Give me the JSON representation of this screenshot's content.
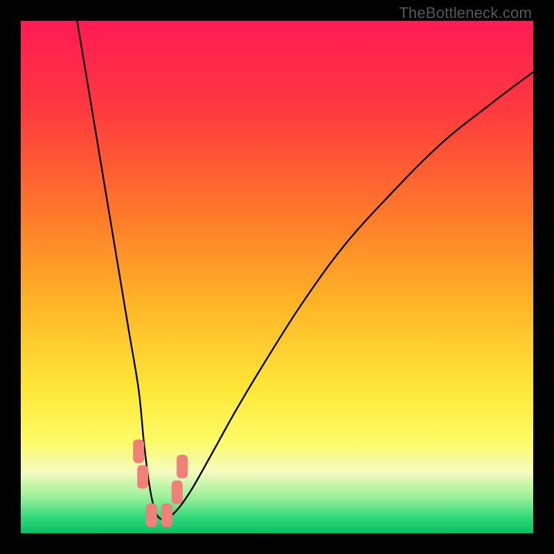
{
  "watermark": "TheBottleneck.com",
  "chart_data": {
    "type": "line",
    "title": "",
    "xlabel": "",
    "ylabel": "",
    "xlim": [
      0,
      100
    ],
    "ylim": [
      0,
      100
    ],
    "series": [
      {
        "name": "bottleneck-curve",
        "x": [
          11,
          13,
          15,
          17,
          19,
          21,
          23,
          24,
          25,
          26,
          27,
          28,
          30,
          33,
          37,
          42,
          48,
          55,
          63,
          72,
          82,
          92,
          100
        ],
        "values": [
          100,
          88,
          76,
          64,
          52,
          40,
          28,
          18,
          10,
          5,
          3,
          3,
          4,
          8,
          15,
          24,
          34,
          45,
          56,
          66,
          76,
          84,
          90
        ]
      }
    ],
    "markers": [
      {
        "name": "marker-1",
        "x": 23.0,
        "y": 16.0
      },
      {
        "name": "marker-2",
        "x": 23.8,
        "y": 11.0
      },
      {
        "name": "marker-3",
        "x": 25.5,
        "y": 3.5
      },
      {
        "name": "marker-4",
        "x": 28.5,
        "y": 3.5
      },
      {
        "name": "marker-5",
        "x": 30.5,
        "y": 8.0
      },
      {
        "name": "marker-6",
        "x": 31.5,
        "y": 13.0
      }
    ],
    "gradient_stops": [
      {
        "offset": 0.0,
        "color": "#ff1a55"
      },
      {
        "offset": 0.18,
        "color": "#ff3b3e"
      },
      {
        "offset": 0.38,
        "color": "#ff7a2a"
      },
      {
        "offset": 0.55,
        "color": "#ffb427"
      },
      {
        "offset": 0.72,
        "color": "#ffe838"
      },
      {
        "offset": 0.82,
        "color": "#fdfb66"
      },
      {
        "offset": 0.88,
        "color": "#f5fbc0"
      },
      {
        "offset": 0.93,
        "color": "#9bf09a"
      },
      {
        "offset": 0.97,
        "color": "#2ed97a"
      },
      {
        "offset": 1.0,
        "color": "#0bbf62"
      }
    ],
    "marker_style": {
      "fill": "#f28079",
      "rx": 6,
      "width": 16,
      "height": 34
    }
  }
}
